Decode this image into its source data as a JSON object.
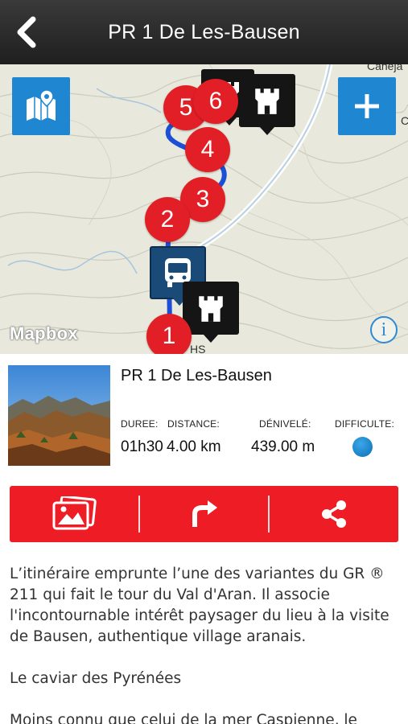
{
  "header": {
    "title": "PR 1 De Les-Bausen",
    "back_icon": "chevron-left-icon"
  },
  "map": {
    "attribution": "Mapbox",
    "info_label": "i",
    "place_labels": [
      "Caneja",
      "C",
      "HS"
    ],
    "route_steps": [
      "1",
      "2",
      "3",
      "4",
      "5",
      "6"
    ],
    "colors": {
      "route": "#1d4fd6",
      "river": "#ffffff",
      "step_marker": "#e21f26",
      "map_button": "#1f86d1"
    }
  },
  "route": {
    "title": "PR 1 De Les-Bausen",
    "stats": {
      "duration_label": "DUREE:",
      "duration_value": "01h30",
      "distance_label": "DISTANCE:",
      "distance_value": "4.00 km",
      "elevation_label": "DÉNIVELÉ:",
      "elevation_value": "439.00 m",
      "difficulty_label": "DIFFICULTE:",
      "difficulty_color": "#1a8fd8"
    }
  },
  "actions": {
    "color": "#ee1d25",
    "items": [
      "gallery-icon",
      "directions-icon",
      "share-icon"
    ]
  },
  "description": {
    "paragraphs": [
      "L’itinéraire emprunte l’une des variantes du GR ® 211 qui fait le tour du Val d'Aran. Il associe l'incontournable intérêt paysager du lieu à la visite de Bausen, authentique village aranais.",
      "Le caviar des Pyrénées",
      "Moins connu que celui de la mer Caspienne, le"
    ]
  }
}
